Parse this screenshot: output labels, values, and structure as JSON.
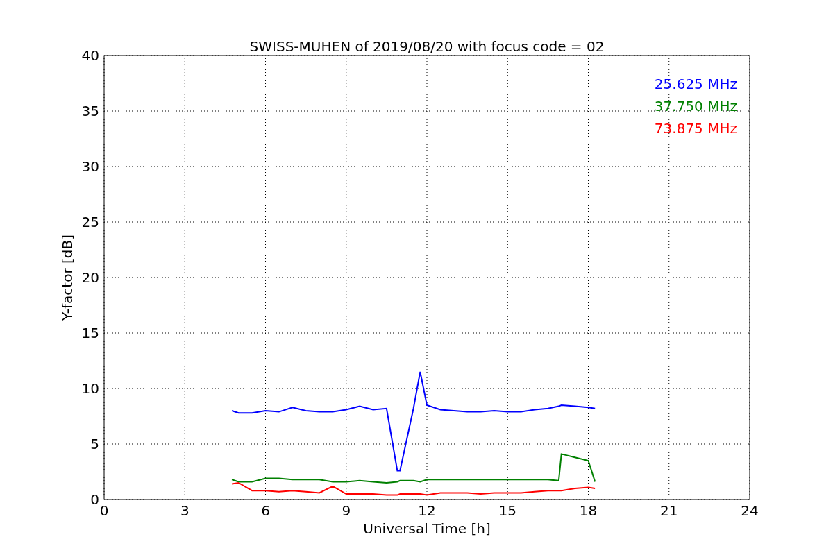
{
  "chart_data": {
    "type": "line",
    "title": "SWISS-MUHEN of 2019/08/20 with focus code = 02",
    "xlabel": "Universal Time [h]",
    "ylabel": "Y-factor [dB]",
    "x": [
      4.75,
      5,
      5.5,
      6,
      6.5,
      7,
      7.5,
      8,
      8.5,
      9,
      9.5,
      10,
      10.5,
      10.9,
      11,
      11.5,
      11.75,
      12,
      12.5,
      13,
      13.5,
      14,
      14.5,
      15,
      15.5,
      16,
      16.5,
      16.9,
      17,
      17.5,
      18,
      18.25
    ],
    "series": [
      {
        "name": "25.625 MHz",
        "color": "#0000ff",
        "values": [
          8,
          7.8,
          7.8,
          8,
          7.9,
          8.3,
          8,
          7.9,
          7.9,
          8.1,
          8.4,
          8.1,
          8.2,
          2.6,
          2.6,
          8.2,
          11.5,
          8.5,
          8.1,
          8,
          7.9,
          7.9,
          8,
          7.9,
          7.9,
          8.1,
          8.2,
          8.4,
          8.5,
          8.4,
          8.3,
          8.2
        ]
      },
      {
        "name": "37.750 MHz",
        "color": "#008000",
        "values": [
          1.8,
          1.6,
          1.6,
          1.9,
          1.9,
          1.8,
          1.8,
          1.8,
          1.6,
          1.6,
          1.7,
          1.6,
          1.5,
          1.6,
          1.7,
          1.7,
          1.6,
          1.8,
          1.8,
          1.8,
          1.8,
          1.8,
          1.8,
          1.8,
          1.8,
          1.8,
          1.8,
          1.7,
          4.1,
          3.8,
          3.5,
          1.6
        ]
      },
      {
        "name": "73.875 MHz",
        "color": "#ff0000",
        "values": [
          1.4,
          1.5,
          0.8,
          0.8,
          0.7,
          0.8,
          0.7,
          0.6,
          1.2,
          0.5,
          0.5,
          0.5,
          0.4,
          0.4,
          0.5,
          0.5,
          0.5,
          0.4,
          0.6,
          0.6,
          0.6,
          0.5,
          0.6,
          0.6,
          0.6,
          0.7,
          0.8,
          0.8,
          0.8,
          1.0,
          1.1,
          1.0
        ]
      }
    ],
    "xlim": [
      0,
      24
    ],
    "ylim": [
      0,
      40
    ],
    "xticks": [
      0,
      3,
      6,
      9,
      12,
      15,
      18,
      21,
      24
    ],
    "yticks": [
      0,
      5,
      10,
      15,
      20,
      25,
      30,
      35,
      40
    ],
    "grid": true
  }
}
